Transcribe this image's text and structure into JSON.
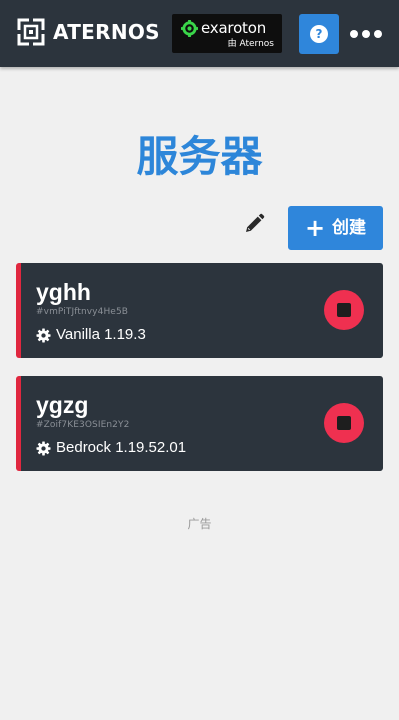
{
  "header": {
    "brand": "ATERNOS",
    "brand_icon": "aternos-logo-icon",
    "partner": {
      "name": "exaroton",
      "sub": "由 Aternos",
      "icon": "exaroton-logo-icon"
    },
    "help_icon": "?",
    "more_icon": "more-icon"
  },
  "page": {
    "title": "服务器",
    "create_label": "创建",
    "create_icon": "+",
    "edit_icon": "pencil-icon"
  },
  "servers": [
    {
      "name": "yghh",
      "id": "#vmPiTJftnvy4He5B",
      "software": "Vanilla 1.19.3",
      "status_color": "#e0273f",
      "action_icon": "stop-icon"
    },
    {
      "name": "ygzg",
      "id": "#Zoif7KE3OSIEn2Y2",
      "software": "Bedrock 1.19.52.01",
      "status_color": "#e0273f",
      "action_icon": "stop-icon"
    }
  ],
  "ad": {
    "label": "广告"
  },
  "colors": {
    "accent": "#2f86db",
    "title": "#2d86d9",
    "topbar": "#2c343d",
    "card": "#2c343d",
    "stop": "#ef3050",
    "background": "#f0f0f0"
  }
}
